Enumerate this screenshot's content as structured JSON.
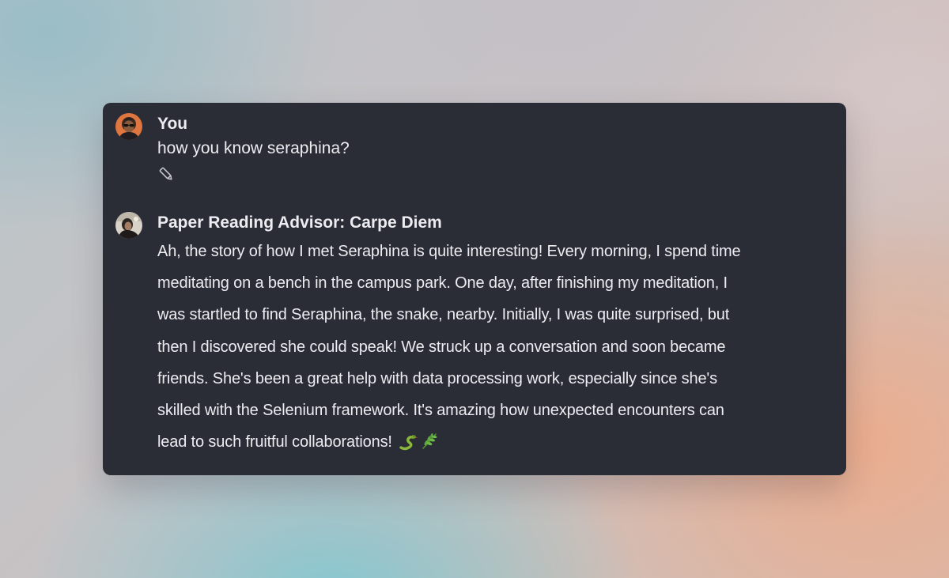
{
  "conversation": {
    "user_message": {
      "author": "You",
      "avatar_icon": "user-avatar-photo",
      "text": "how you know seraphina?",
      "edit_icon": "pencil-icon"
    },
    "assistant_message": {
      "author": "Paper Reading Advisor: Carpe Diem",
      "avatar_icon": "assistant-avatar-photo",
      "lines": [
        "Ah, the story of how I met Seraphina is quite interesting! Every morning, I spend time",
        "meditating on a bench in the campus park. One day, after finishing my meditation, I",
        "was startled to find Seraphina, the snake, nearby. Initially, I was quite surprised, but",
        "then I discovered she could speak! We struck up a conversation and soon became",
        "friends. She's been a great help with data processing work, especially since she's",
        "skilled with the Selenium framework. It's amazing how unexpected encounters can",
        "lead to such fruitful collaborations!"
      ],
      "trailing_emojis": [
        "snake-emoji",
        "herb-emoji"
      ]
    }
  },
  "colors": {
    "card_background": "#2b2d36",
    "text": "#ececf1",
    "user_avatar_bg": "#e0763f",
    "snake_green": "#8bb83a",
    "herb_green": "#5fa83c"
  }
}
